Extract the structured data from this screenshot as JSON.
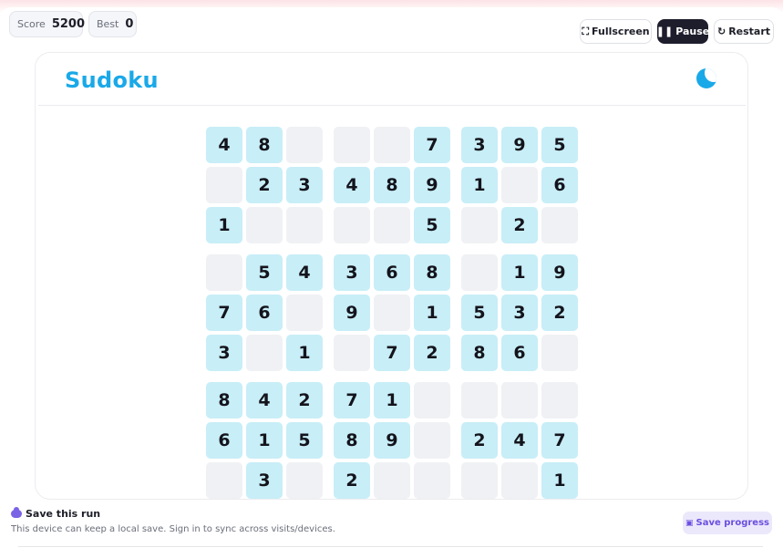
{
  "stats": {
    "score_label": "Score",
    "score_value": "5200",
    "best_label": "Best",
    "best_value": "0"
  },
  "toolbar": {
    "fullscreen_label": "Fullscreen",
    "pause_label": "Pause",
    "restart_label": "Restart"
  },
  "game": {
    "title": "Sudoku",
    "theme_icon": "moon-icon",
    "board": [
      [
        "4",
        "8",
        "",
        "",
        "",
        "7",
        "3",
        "9",
        "5"
      ],
      [
        "",
        "2",
        "3",
        "4",
        "8",
        "9",
        "1",
        "",
        "6"
      ],
      [
        "1",
        "",
        "",
        "",
        "",
        "5",
        "",
        "2",
        ""
      ],
      [
        "",
        "5",
        "4",
        "3",
        "6",
        "8",
        "",
        "1",
        "9"
      ],
      [
        "7",
        "6",
        "",
        "9",
        "",
        "1",
        "5",
        "3",
        "2"
      ],
      [
        "3",
        "",
        "1",
        "",
        "7",
        "2",
        "8",
        "6",
        ""
      ],
      [
        "8",
        "4",
        "2",
        "7",
        "1",
        "",
        "",
        "",
        ""
      ],
      [
        "6",
        "1",
        "5",
        "8",
        "9",
        "",
        "2",
        "4",
        "7"
      ],
      [
        "",
        "3",
        "",
        "2",
        "",
        "",
        "",
        "",
        "1"
      ]
    ]
  },
  "footer": {
    "save_title": "Save this run",
    "save_subtitle": "This device can keep a local save. Sign in to sync across visits/devices.",
    "save_progress_label": "Save progress"
  },
  "colors": {
    "accent": "#1aa9e8",
    "given_cell": "#c8eef7",
    "empty_cell": "#f0f1f4",
    "save_accent": "#6a4fe0"
  }
}
